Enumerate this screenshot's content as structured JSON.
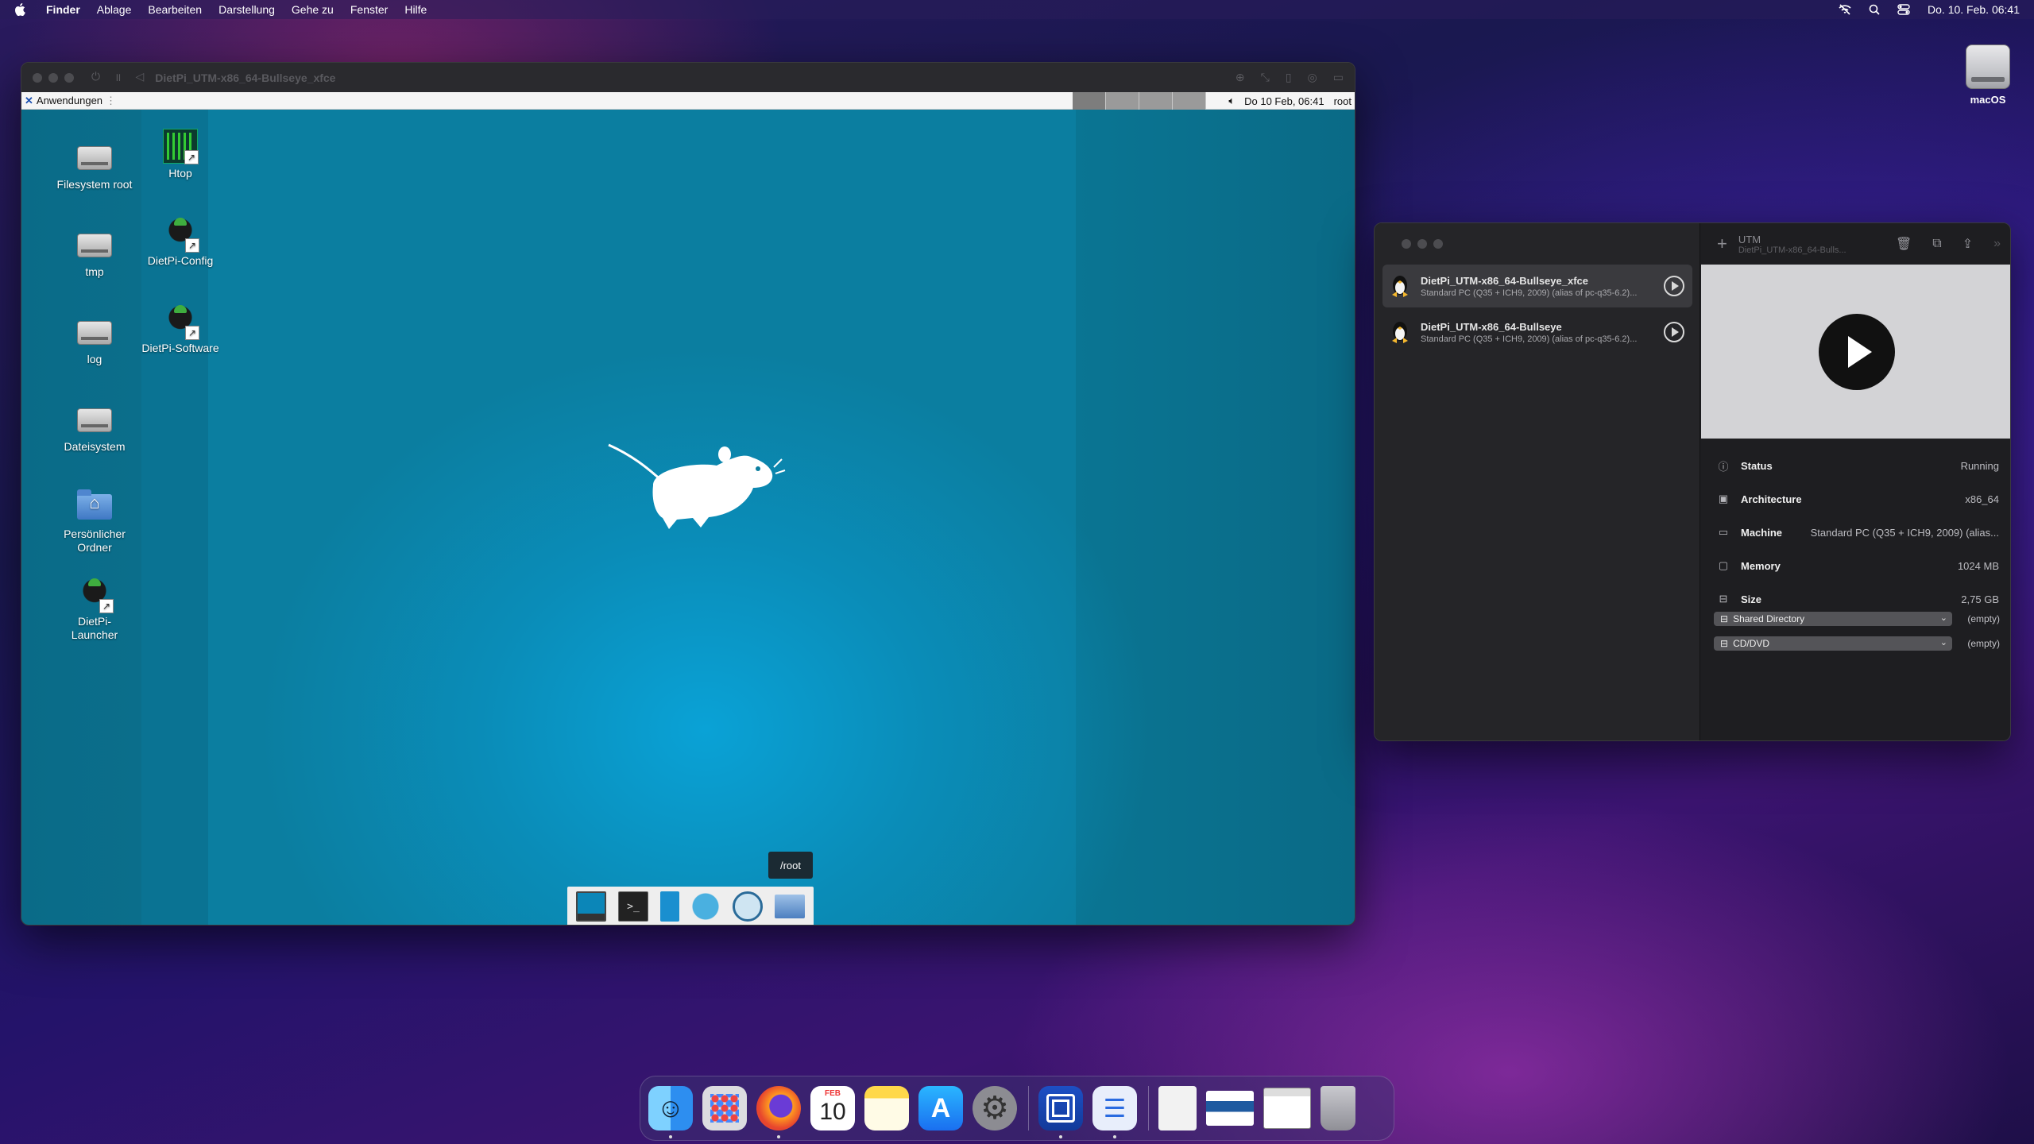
{
  "menubar": {
    "app_name": "Finder",
    "items": [
      "Ablage",
      "Bearbeiten",
      "Darstellung",
      "Gehe zu",
      "Fenster",
      "Hilfe"
    ],
    "clock": "Do. 10. Feb. 06:41"
  },
  "desktop": {
    "disk_label": "macOS"
  },
  "vm_window": {
    "title": "DietPi_UTM-x86_64-Bullseye_xfce",
    "panel": {
      "apps_label": "Anwendungen",
      "clock": "Do 10 Feb, 06:41",
      "user": "root"
    },
    "icons": [
      {
        "label": "Filesystem root",
        "kind": "drive"
      },
      {
        "label": "tmp",
        "kind": "drive"
      },
      {
        "label": "log",
        "kind": "drive"
      },
      {
        "label": "Dateisystem",
        "kind": "drive"
      },
      {
        "label": "Persönlicher Ordner",
        "kind": "home-folder"
      },
      {
        "label": "DietPi-Launcher",
        "kind": "dietpi"
      },
      {
        "label": "Htop",
        "kind": "htop"
      },
      {
        "label": "DietPi-Config",
        "kind": "dietpi"
      },
      {
        "label": "DietPi-Software",
        "kind": "dietpi"
      }
    ],
    "tooltip": "/root",
    "dock_items": [
      "show-desktop",
      "terminal",
      "mouse",
      "web-browser",
      "app-finder",
      "file-manager"
    ]
  },
  "utm": {
    "toolbar_title": "UTM",
    "toolbar_subtitle": "DietPi_UTM-x86_64-Bulls...",
    "vms": [
      {
        "name": "DietPi_UTM-x86_64-Bullseye_xfce",
        "desc": "Standard PC (Q35 + ICH9, 2009) (alias of pc-q35-6.2)...",
        "selected": true
      },
      {
        "name": "DietPi_UTM-x86_64-Bullseye",
        "desc": "Standard PC (Q35 + ICH9, 2009) (alias of pc-q35-6.2)...",
        "selected": false
      }
    ],
    "info": [
      {
        "label": "Status",
        "value": "Running",
        "icon": "info-icon"
      },
      {
        "label": "Architecture",
        "value": "x86_64",
        "icon": "cpu-icon"
      },
      {
        "label": "Machine",
        "value": "Standard PC (Q35 + ICH9, 2009) (alias...",
        "icon": "display-icon"
      },
      {
        "label": "Memory",
        "value": "1024 MB",
        "icon": "memory-icon"
      },
      {
        "label": "Size",
        "value": "2,75 GB",
        "icon": "drive-icon"
      }
    ],
    "shared_directory": {
      "label": "Shared Directory",
      "value": "(empty)"
    },
    "cd_dvd": {
      "label": "CD/DVD",
      "value": "(empty)"
    }
  },
  "dock": {
    "calendar_month": "FEB",
    "calendar_day": "10",
    "apps": [
      "Finder",
      "Launchpad",
      "Firefox",
      "Kalender",
      "Notizen",
      "App Store",
      "Systemeinstellungen",
      "UTM",
      "Dateien",
      "Dokument",
      "Bildschirmfoto",
      "Bildschirmfoto",
      "Papierkorb"
    ]
  }
}
